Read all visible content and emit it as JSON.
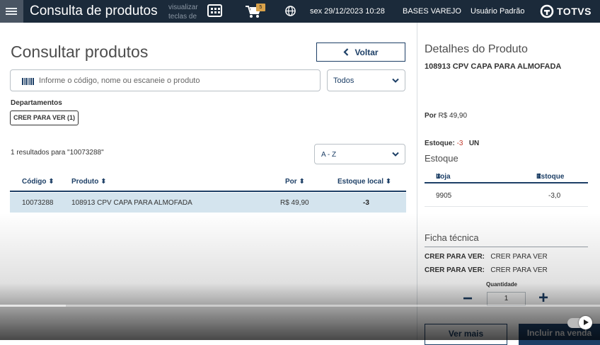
{
  "topbar": {
    "title": "Consulta de produtos",
    "hint": "visualizar teclas de",
    "cart_count": "5",
    "datetime": "sex 29/12/2023 10:28",
    "branch": "BASES VAREJO",
    "user": "Usuário Padrão",
    "brand": "TOTVS"
  },
  "main": {
    "title": "Consultar produtos",
    "back_label": "Voltar",
    "search": {
      "placeholder": "Informe o código, nome ou escaneie o produto",
      "value": ""
    },
    "filter_value": "Todos",
    "departments_label": "Departamentos",
    "department_chip": "CRER PARA VER (1)",
    "results_text": "1 resultados para \"10073288\"",
    "sort_value": "A - Z",
    "table": {
      "headers": [
        "Código",
        "Produto",
        "Por",
        "Estoque local"
      ],
      "rows": [
        {
          "codigo": "10073288",
          "produto": "108913  CPV CAPA PARA ALMOFADA",
          "por": "R$ 49,90",
          "estoque": "-3"
        }
      ]
    }
  },
  "detail": {
    "title": "Detalhes do Produto",
    "product": "108913  CPV CAPA PARA ALMOFADA",
    "price_label": "Por",
    "price_value": "R$ 49,90",
    "stock_label": "Estoque:",
    "stock_value": "-3",
    "stock_unit": "UN",
    "stock_section": "Estoque",
    "stock_table": {
      "headers": [
        "Loja",
        "Estoque"
      ],
      "rows": [
        {
          "loja": "9905",
          "estoque": "-3,0"
        }
      ]
    },
    "ficha_title": "Ficha técnica",
    "specs": [
      {
        "label": "CRER PARA VER:",
        "value": "CRER PARA VER"
      },
      {
        "label": "CRER PARA VER:",
        "value": "CRER PARA VER"
      }
    ],
    "qty_label": "Quantidade",
    "qty_value": "1",
    "more_label": "Ver mais",
    "add_label": "Incluir na venda"
  },
  "video": {
    "progress": 0.11
  },
  "colors": {
    "topbar": "#1b2a3a",
    "accent": "#1d3f66",
    "selected_row": "#d4e4ee",
    "negative": "#c0392b"
  },
  "icons": [
    "menu-icon",
    "keyboard-icon",
    "cart-icon",
    "globe-icon",
    "totvs-logo-icon",
    "chevron-left-icon",
    "barcode-icon",
    "chevron-down-icon",
    "sort-icon",
    "play-icon"
  ]
}
